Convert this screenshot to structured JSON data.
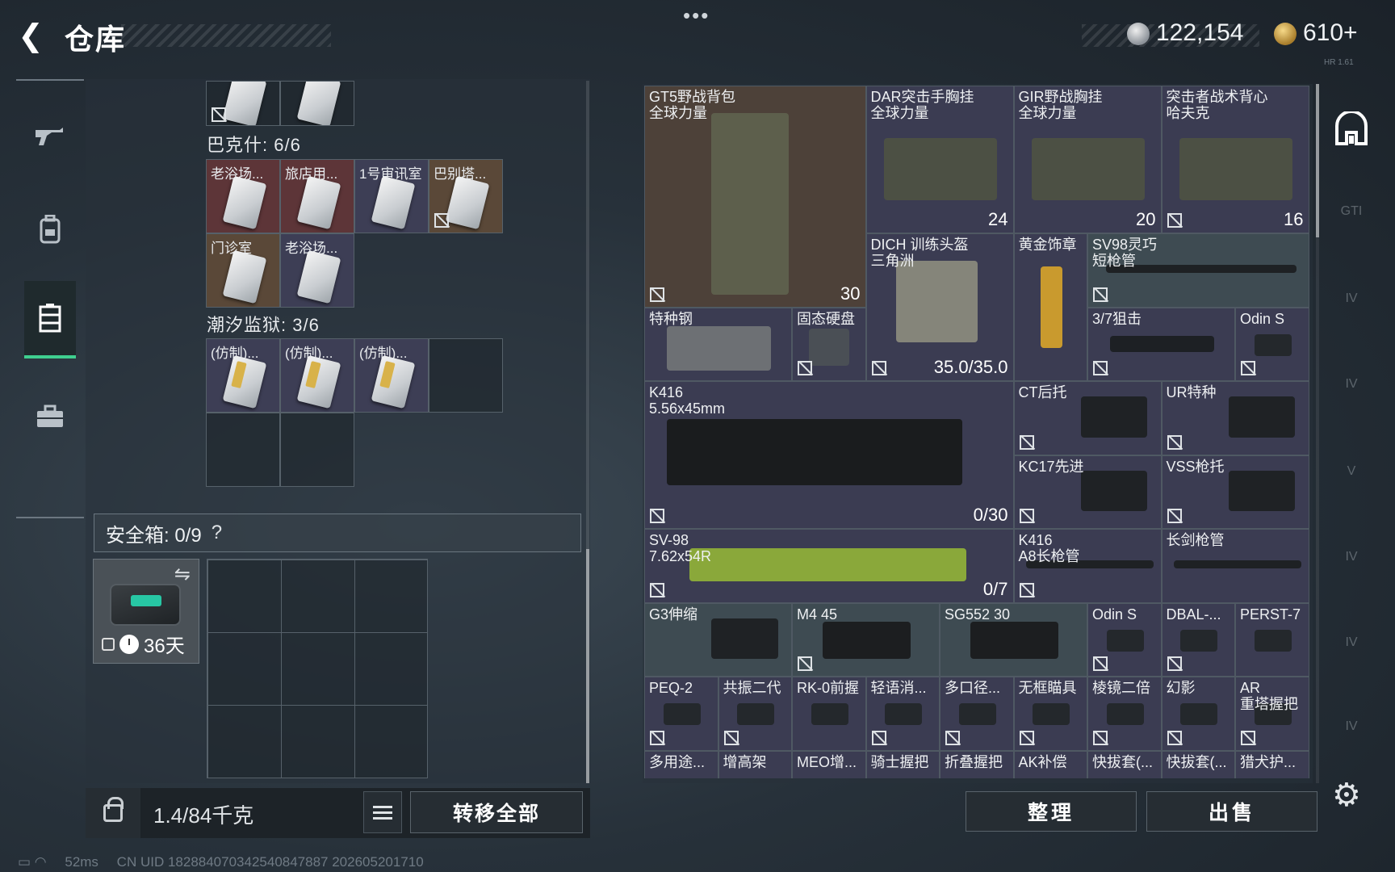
{
  "header": {
    "back_icon": "back-arrow-icon",
    "title": "仓库",
    "more": "•••",
    "currency_silver": "122,154",
    "currency_gold": "610+",
    "version": "HR 1.61"
  },
  "left_nav": [
    "gun-icon",
    "backpack-icon",
    "locker-icon",
    "briefcase-icon"
  ],
  "left_panel": {
    "section_bakeshi": "巴克什: 6/6",
    "bakeshi_items": [
      "老浴场...",
      "旅店用...",
      "1号审讯室",
      "巴别塔...",
      "门诊室",
      "老浴场..."
    ],
    "section_chaoxi": "潮汐监狱: 3/6",
    "chaoxi_items": [
      "(仿制)...",
      "(仿制)...",
      "(仿制)..."
    ],
    "safebox_title": "安全箱: 0/9",
    "safebox_help": "?",
    "safebox_days": "36天",
    "weight": "1.4/84千克",
    "transfer_all": "转移全部"
  },
  "warehouse": {
    "items": [
      {
        "label": "GT5野战背包\n全球力量",
        "count": "30"
      },
      {
        "label": "DAR突击手胸挂\n全球力量",
        "count": "24"
      },
      {
        "label": "GIR野战胸挂\n全球力量",
        "count": "20"
      },
      {
        "label": "突击者战术背心\n哈夫克",
        "count": "16"
      },
      {
        "label": "DICH 训练头盔\n三角洲",
        "count": "35.0/35.0"
      },
      {
        "label": "黄金饰章",
        "count": ""
      },
      {
        "label": "SV98灵巧\n短枪管",
        "count": ""
      },
      {
        "label": "特种钢",
        "count": ""
      },
      {
        "label": "固态硬盘",
        "count": ""
      },
      {
        "label": "3/7狙击",
        "count": ""
      },
      {
        "label": "Odin S",
        "count": ""
      },
      {
        "label": "K416\n5.56x45mm",
        "count": "0/30"
      },
      {
        "label": "CT后托",
        "count": ""
      },
      {
        "label": "UR特种",
        "count": ""
      },
      {
        "label": "KC17先进",
        "count": ""
      },
      {
        "label": "VSS枪托",
        "count": ""
      },
      {
        "label": "SV-98\n7.62x54R",
        "count": "0/7"
      },
      {
        "label": "K416\nA8长枪管",
        "count": ""
      },
      {
        "label": "长剑枪管",
        "count": ""
      },
      {
        "label": "G3伸缩",
        "count": ""
      },
      {
        "label": "M4 45",
        "count": ""
      },
      {
        "label": "SG552 30",
        "count": ""
      },
      {
        "label": "Odin S",
        "count": ""
      },
      {
        "label": "DBAL-...",
        "count": ""
      },
      {
        "label": "PERST-7",
        "count": ""
      },
      {
        "label": "PEQ-2",
        "count": ""
      },
      {
        "label": "共振二代",
        "count": ""
      },
      {
        "label": "RK-0前握",
        "count": ""
      },
      {
        "label": "轻语消...",
        "count": ""
      },
      {
        "label": "多口径...",
        "count": ""
      },
      {
        "label": "无框瞄具",
        "count": ""
      },
      {
        "label": "棱镜二倍",
        "count": ""
      },
      {
        "label": "幻影",
        "count": ""
      },
      {
        "label": "AR\n重塔握把",
        "count": ""
      },
      {
        "label": "多用途...",
        "count": ""
      },
      {
        "label": "增高架",
        "count": ""
      },
      {
        "label": "MEO增...",
        "count": ""
      },
      {
        "label": "骑士握把",
        "count": ""
      },
      {
        "label": "折叠握把",
        "count": ""
      },
      {
        "label": "AK补偿",
        "count": ""
      },
      {
        "label": "快拔套(...",
        "count": ""
      },
      {
        "label": "快拔套(...",
        "count": ""
      },
      {
        "label": "猎犬护...",
        "count": ""
      }
    ],
    "sort_button": "整理",
    "sell_button": "出售"
  },
  "right_rail": [
    "home-base-icon",
    "GTI",
    "IV",
    "IV",
    "V",
    "IV",
    "IV",
    "IV"
  ],
  "status_bar": {
    "ping": "52ms",
    "uid": "CN UID 182884070342540847887 202605201710"
  },
  "colors": {
    "accent_green": "#3fcf8f",
    "cell_red": "#5d3538",
    "cell_brown": "#5a4838",
    "cell_navy": "#3b3c52"
  }
}
